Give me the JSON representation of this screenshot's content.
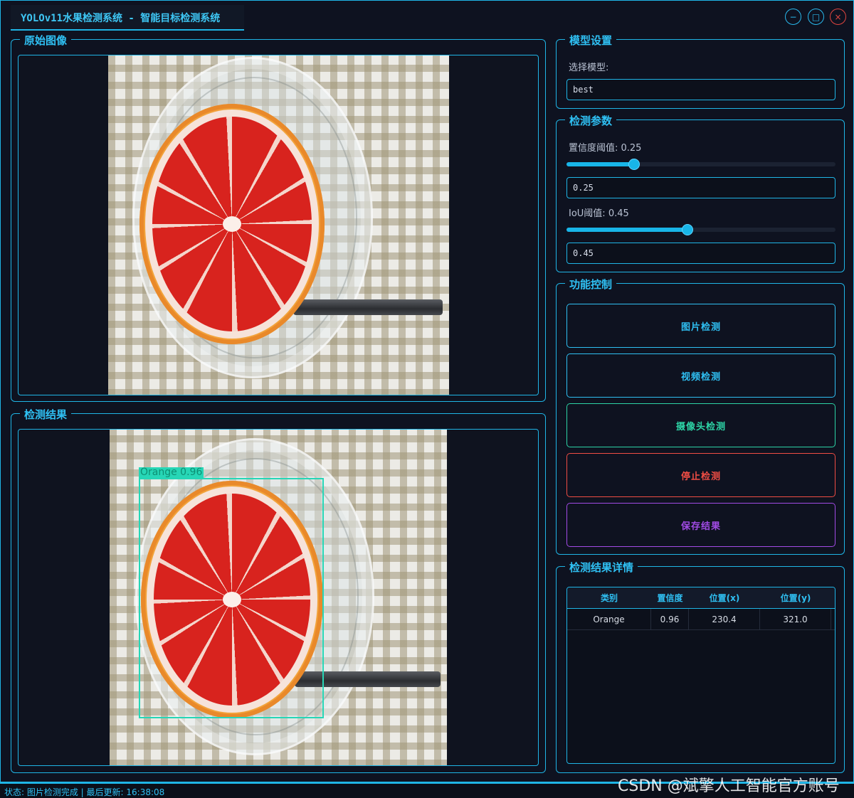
{
  "window": {
    "title": "YOLOv11水果检测系统 - 智能目标检测系统",
    "controls": {
      "minimize": "−",
      "maximize": "□",
      "close": "×"
    }
  },
  "original_panel": {
    "title": "原始图像"
  },
  "result_panel": {
    "title": "检测结果",
    "detection_label": "Orange 0.96"
  },
  "model_settings": {
    "title": "模型设置",
    "select_label": "选择模型:",
    "selected_model": "best"
  },
  "detection_params": {
    "title": "检测参数",
    "confidence_label": "置信度阈值: 0.25",
    "confidence_value": "0.25",
    "confidence_slider_fraction": 0.25,
    "iou_label": "IoU阈值: 0.45",
    "iou_value": "0.45",
    "iou_slider_fraction": 0.45
  },
  "function_control": {
    "title": "功能控制",
    "buttons": [
      {
        "label": "图片检测",
        "color": "#2fc0f3"
      },
      {
        "label": "视频检测",
        "color": "#2fc0f3"
      },
      {
        "label": "摄像头检测",
        "color": "#2dd4a6"
      },
      {
        "label": "停止检测",
        "color": "#ef4d44"
      },
      {
        "label": "保存结果",
        "color": "#a24be6"
      }
    ]
  },
  "results_detail": {
    "title": "检测结果详情",
    "columns": [
      "类别",
      "置信度",
      "位置(x)",
      "位置(y)"
    ],
    "rows": [
      [
        "Orange",
        "0.96",
        "230.4",
        "321.0"
      ]
    ]
  },
  "statusbar": {
    "text": "状态: 图片检测完成 | 最后更新: 16:38:08"
  },
  "watermark": "CSDN @斌擎人工智能官方账号"
}
